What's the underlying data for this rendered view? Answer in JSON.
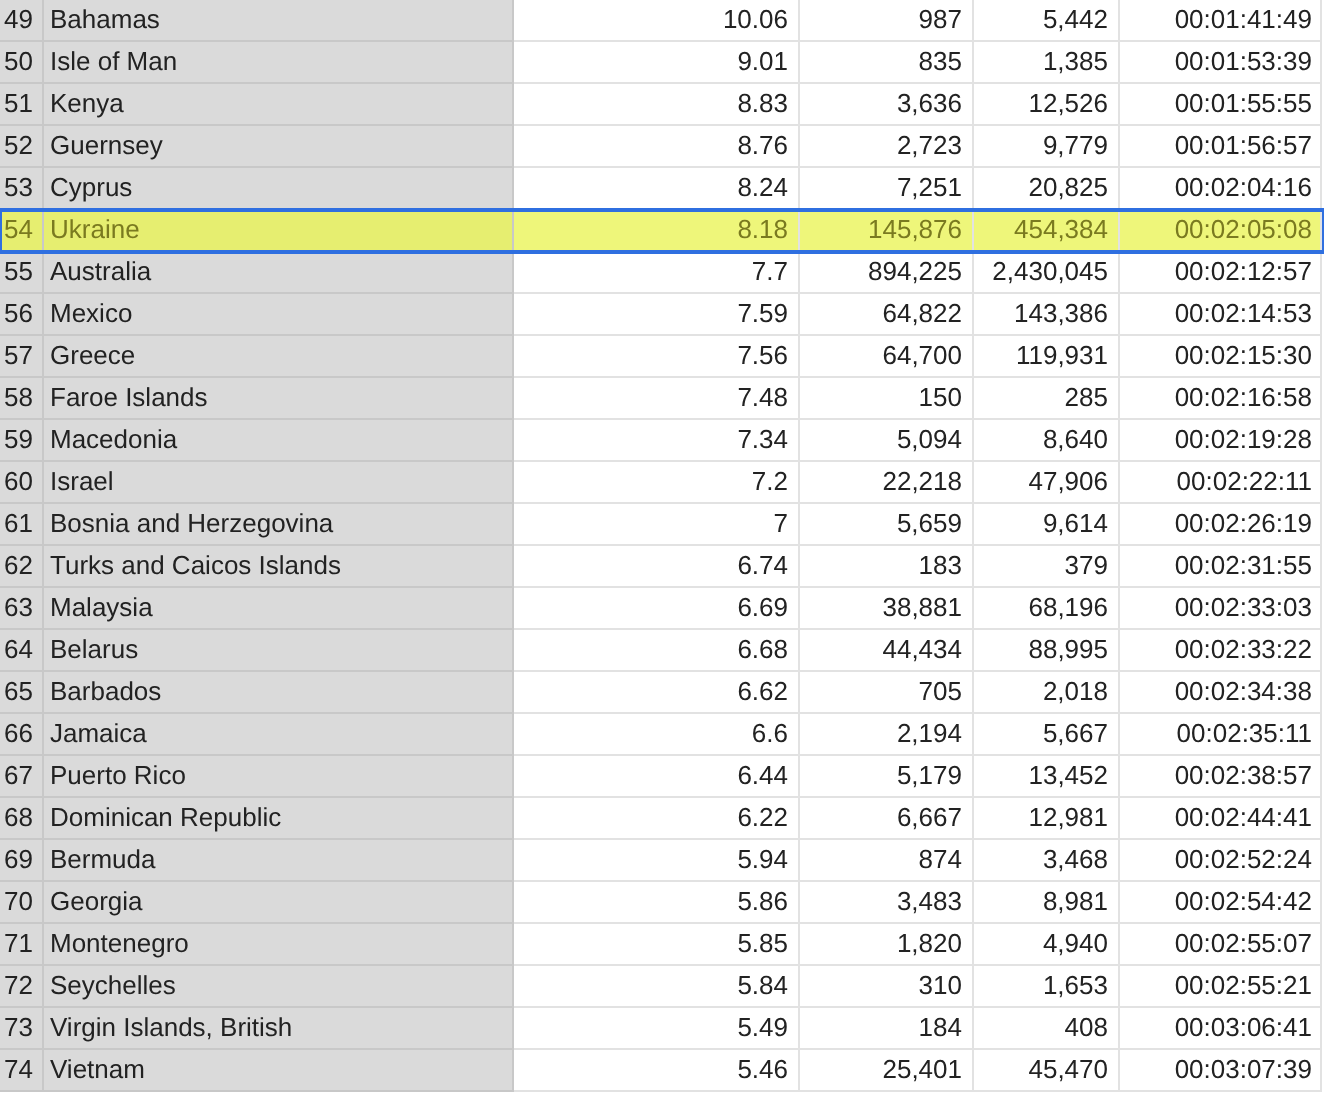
{
  "rows": [
    {
      "rank": "49",
      "country": "Bahamas",
      "col_3": "10.06",
      "col_4": "987",
      "col_5": "5,442",
      "col_6": "00:01:41:49",
      "selected": false
    },
    {
      "rank": "50",
      "country": "Isle of Man",
      "col_3": "9.01",
      "col_4": "835",
      "col_5": "1,385",
      "col_6": "00:01:53:39",
      "selected": false
    },
    {
      "rank": "51",
      "country": "Kenya",
      "col_3": "8.83",
      "col_4": "3,636",
      "col_5": "12,526",
      "col_6": "00:01:55:55",
      "selected": false
    },
    {
      "rank": "52",
      "country": "Guernsey",
      "col_3": "8.76",
      "col_4": "2,723",
      "col_5": "9,779",
      "col_6": "00:01:56:57",
      "selected": false
    },
    {
      "rank": "53",
      "country": "Cyprus",
      "col_3": "8.24",
      "col_4": "7,251",
      "col_5": "20,825",
      "col_6": "00:02:04:16",
      "selected": false
    },
    {
      "rank": "54",
      "country": "Ukraine",
      "col_3": "8.18",
      "col_4": "145,876",
      "col_5": "454,384",
      "col_6": "00:02:05:08",
      "selected": true
    },
    {
      "rank": "55",
      "country": "Australia",
      "col_3": "7.7",
      "col_4": "894,225",
      "col_5": "2,430,045",
      "col_6": "00:02:12:57",
      "selected": false
    },
    {
      "rank": "56",
      "country": "Mexico",
      "col_3": "7.59",
      "col_4": "64,822",
      "col_5": "143,386",
      "col_6": "00:02:14:53",
      "selected": false
    },
    {
      "rank": "57",
      "country": "Greece",
      "col_3": "7.56",
      "col_4": "64,700",
      "col_5": "119,931",
      "col_6": "00:02:15:30",
      "selected": false
    },
    {
      "rank": "58",
      "country": "Faroe Islands",
      "col_3": "7.48",
      "col_4": "150",
      "col_5": "285",
      "col_6": "00:02:16:58",
      "selected": false
    },
    {
      "rank": "59",
      "country": "Macedonia",
      "col_3": "7.34",
      "col_4": "5,094",
      "col_5": "8,640",
      "col_6": "00:02:19:28",
      "selected": false
    },
    {
      "rank": "60",
      "country": "Israel",
      "col_3": "7.2",
      "col_4": "22,218",
      "col_5": "47,906",
      "col_6": "00:02:22:11",
      "selected": false
    },
    {
      "rank": "61",
      "country": "Bosnia and Herzegovina",
      "col_3": "7",
      "col_4": "5,659",
      "col_5": "9,614",
      "col_6": "00:02:26:19",
      "selected": false
    },
    {
      "rank": "62",
      "country": "Turks and Caicos Islands",
      "col_3": "6.74",
      "col_4": "183",
      "col_5": "379",
      "col_6": "00:02:31:55",
      "selected": false
    },
    {
      "rank": "63",
      "country": "Malaysia",
      "col_3": "6.69",
      "col_4": "38,881",
      "col_5": "68,196",
      "col_6": "00:02:33:03",
      "selected": false
    },
    {
      "rank": "64",
      "country": "Belarus",
      "col_3": "6.68",
      "col_4": "44,434",
      "col_5": "88,995",
      "col_6": "00:02:33:22",
      "selected": false
    },
    {
      "rank": "65",
      "country": "Barbados",
      "col_3": "6.62",
      "col_4": "705",
      "col_5": "2,018",
      "col_6": "00:02:34:38",
      "selected": false
    },
    {
      "rank": "66",
      "country": "Jamaica",
      "col_3": "6.6",
      "col_4": "2,194",
      "col_5": "5,667",
      "col_6": "00:02:35:11",
      "selected": false
    },
    {
      "rank": "67",
      "country": "Puerto Rico",
      "col_3": "6.44",
      "col_4": "5,179",
      "col_5": "13,452",
      "col_6": "00:02:38:57",
      "selected": false
    },
    {
      "rank": "68",
      "country": "Dominican Republic",
      "col_3": "6.22",
      "col_4": "6,667",
      "col_5": "12,981",
      "col_6": "00:02:44:41",
      "selected": false
    },
    {
      "rank": "69",
      "country": "Bermuda",
      "col_3": "5.94",
      "col_4": "874",
      "col_5": "3,468",
      "col_6": "00:02:52:24",
      "selected": false
    },
    {
      "rank": "70",
      "country": "Georgia",
      "col_3": "5.86",
      "col_4": "3,483",
      "col_5": "8,981",
      "col_6": "00:02:54:42",
      "selected": false
    },
    {
      "rank": "71",
      "country": "Montenegro",
      "col_3": "5.85",
      "col_4": "1,820",
      "col_5": "4,940",
      "col_6": "00:02:55:07",
      "selected": false
    },
    {
      "rank": "72",
      "country": "Seychelles",
      "col_3": "5.84",
      "col_4": "310",
      "col_5": "1,653",
      "col_6": "00:02:55:21",
      "selected": false
    },
    {
      "rank": "73",
      "country": "Virgin Islands, British",
      "col_3": "5.49",
      "col_4": "184",
      "col_5": "408",
      "col_6": "00:03:06:41",
      "selected": false
    },
    {
      "rank": "74",
      "country": "Vietnam",
      "col_3": "5.46",
      "col_4": "25,401",
      "col_5": "45,470",
      "col_6": "00:03:07:39",
      "selected": false
    }
  ]
}
